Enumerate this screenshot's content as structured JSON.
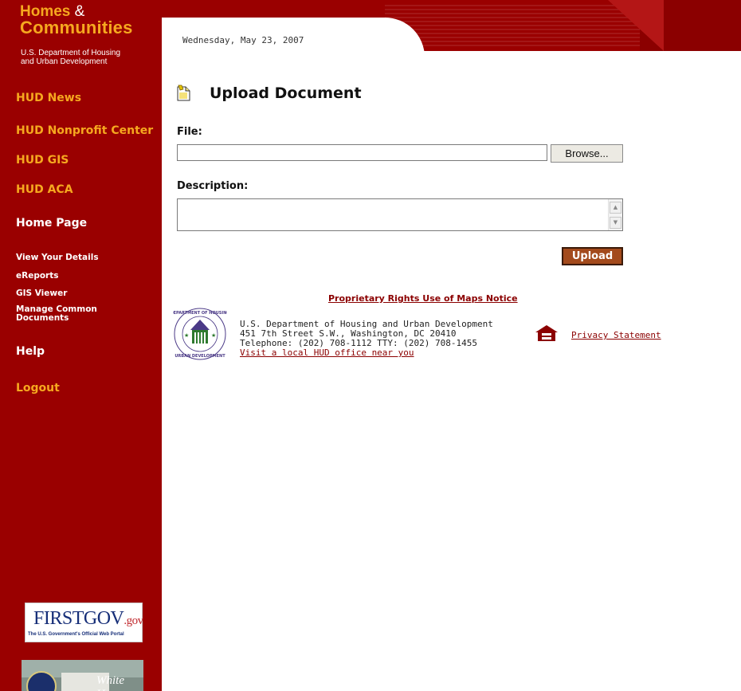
{
  "brand": {
    "line1": "Homes",
    "amp": "&",
    "line2": "Communities",
    "sub1": "U.S. Department of Housing",
    "sub2": "and Urban Development"
  },
  "sidebar": {
    "items": [
      {
        "label": "HUD News"
      },
      {
        "label": "HUD Nonprofit Center"
      },
      {
        "label": "HUD GIS"
      },
      {
        "label": "HUD ACA"
      },
      {
        "label": "Home Page"
      },
      {
        "label": "View Your Details"
      },
      {
        "label": "eReports"
      },
      {
        "label": "GIS Viewer"
      },
      {
        "label": "Manage Common"
      },
      {
        "label": "Documents"
      },
      {
        "label": "Help"
      },
      {
        "label": "Logout"
      }
    ],
    "firstgov": {
      "main": "FIRSTGOV",
      "suffix": ".gov",
      "tagline": "The U.S. Government's Official Web Portal"
    },
    "whitehouse": {
      "text": "White House"
    }
  },
  "header": {
    "date": "Wednesday, May 23, 2007"
  },
  "main": {
    "title": "Upload Document",
    "file_label": "File:",
    "file_value": "",
    "browse_label": "Browse...",
    "description_label": "Description:",
    "description_value": "",
    "upload_label": "Upload"
  },
  "footer": {
    "rights_link": "Proprietary Rights Use of Maps Notice",
    "address": [
      "U.S. Department of Housing and Urban Development",
      "451 7th Street S.W., Washington, DC 20410",
      "Telephone: (202) 708-1112  TTY: (202) 708-1455"
    ],
    "office_link": "Visit a local HUD office near you",
    "privacy_link": "Privacy Statement"
  },
  "colors": {
    "brand_red": "#9a0000",
    "accent_orange": "#f6a81f",
    "link_red": "#8b0000",
    "upload_brown": "#a34a1c"
  }
}
